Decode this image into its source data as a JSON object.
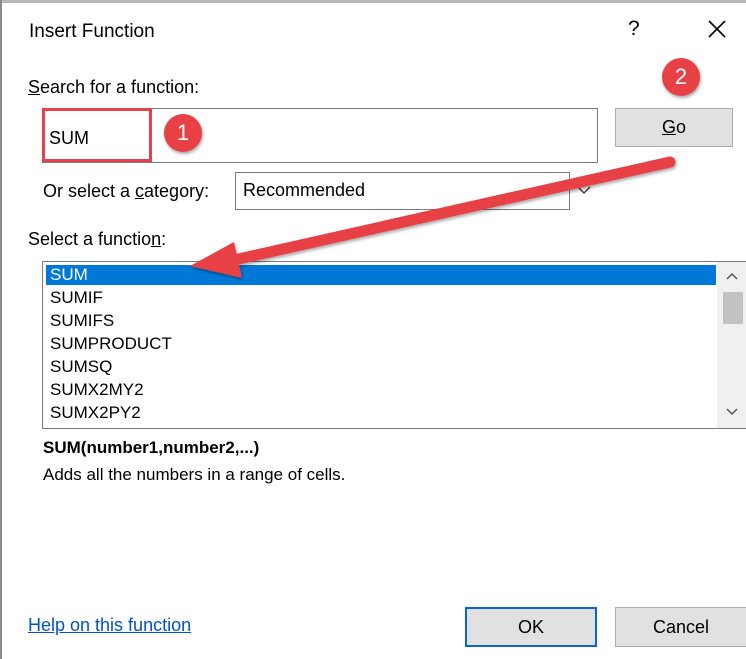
{
  "dialog": {
    "title": "Insert Function",
    "help_glyph": "?",
    "close_icon": "close-icon"
  },
  "search": {
    "label_mnemonic": "S",
    "label_rest": "earch for a function:",
    "value": "SUM",
    "go_mnemonic": "G",
    "go_rest": "o"
  },
  "category": {
    "label_before": "Or select a ",
    "label_mnemonic": "c",
    "label_after": "ategory:",
    "selected": "Recommended",
    "dropdown_icon": "chevron-down-icon"
  },
  "functions": {
    "label_before": "Select a functio",
    "label_mnemonic": "n",
    "label_after": ":",
    "items": [
      "SUM",
      "SUMIF",
      "SUMIFS",
      "SUMPRODUCT",
      "SUMSQ",
      "SUMX2MY2",
      "SUMX2PY2"
    ],
    "selected_index": 0
  },
  "details": {
    "signature": "SUM(number1,number2,...)",
    "description": "Adds all the numbers in a range of cells."
  },
  "footer": {
    "help_link": "Help on this function",
    "ok_label": "OK",
    "cancel_label": "Cancel"
  },
  "annotations": {
    "badge_1": "1",
    "badge_2": "2",
    "accent_color": "#e74045"
  },
  "colors": {
    "selection": "#0078d7",
    "link": "#0052cc"
  }
}
